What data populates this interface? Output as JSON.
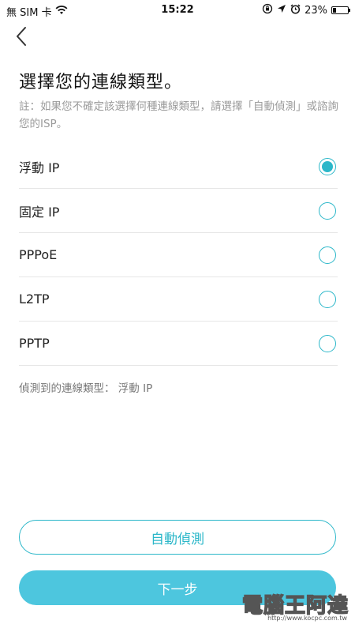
{
  "status_bar": {
    "carrier": "無 SIM 卡",
    "time": "15:22",
    "battery_percent": "23%",
    "battery_level": 0.23,
    "icons": [
      "wifi-icon",
      "lock-rotation-icon",
      "location-icon",
      "alarm-icon",
      "battery-icon"
    ]
  },
  "header": {
    "back_icon": "chevron-left-icon"
  },
  "title": "選擇您的連線類型。",
  "note": "註：如果您不確定該選擇何種連線類型，請選擇「自動偵測」或諮詢您的ISP。",
  "options": [
    {
      "label": "浮動 IP",
      "selected": true
    },
    {
      "label": "固定 IP",
      "selected": false
    },
    {
      "label": "PPPoE",
      "selected": false
    },
    {
      "label": "L2TP",
      "selected": false
    },
    {
      "label": "PPTP",
      "selected": false
    }
  ],
  "detected": {
    "label": "偵測到的連線類型：",
    "value": "浮動 IP"
  },
  "buttons": {
    "auto_detect": "自動偵測",
    "next": "下一步"
  },
  "watermark": {
    "text": "電腦王阿達",
    "url": "http://www.kocpc.com.tw"
  },
  "colors": {
    "accent": "#2bb7c9",
    "next_button": "#4dc6de"
  }
}
